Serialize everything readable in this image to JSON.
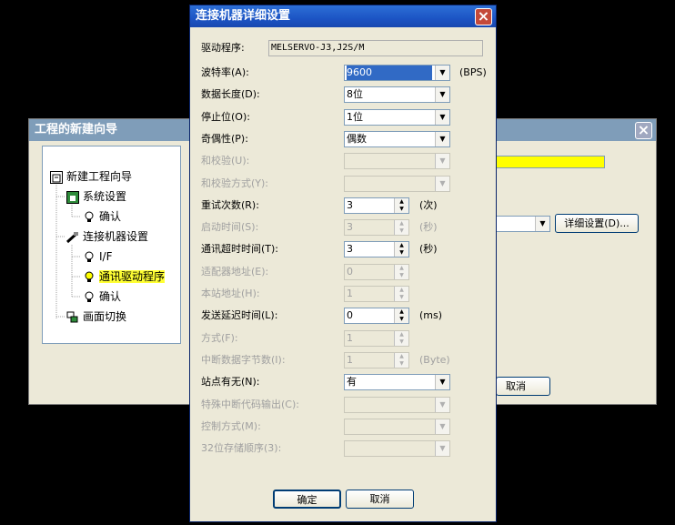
{
  "wizard": {
    "title": "工程的新建向导",
    "close": "×",
    "tree": [
      {
        "label": "新建工程向导"
      },
      {
        "label": "系统设置"
      },
      {
        "label": "确认"
      },
      {
        "label": "连接机器设置"
      },
      {
        "label": "I/F"
      },
      {
        "label": "通讯驱动程序"
      },
      {
        "label": "确认"
      },
      {
        "label": "画面切换"
      }
    ],
    "detail_button": "详细设置(D)...",
    "cancel_button": "取消",
    "highlight_color": "#ffff00"
  },
  "dialog": {
    "title": "连接机器详细设置",
    "close": "×",
    "driver_label": "驱动程序:",
    "driver_value": "MELSERVO-J3,J2S/M",
    "rows": [
      {
        "label": "波特率(A):",
        "value": "9600",
        "unit": "(BPS)",
        "type": "combo",
        "enabled": true,
        "selected": true
      },
      {
        "label": "数据长度(D):",
        "value": "8位",
        "type": "combo",
        "enabled": true
      },
      {
        "label": "停止位(O):",
        "value": "1位",
        "type": "combo",
        "enabled": true
      },
      {
        "label": "奇偶性(P):",
        "value": "偶数",
        "type": "combo",
        "enabled": true
      },
      {
        "label": "和校验(U):",
        "value": "",
        "type": "combo",
        "enabled": false
      },
      {
        "label": "和校验方式(Y):",
        "value": "",
        "type": "combo",
        "enabled": false
      },
      {
        "label": "重试次数(R):",
        "value": "3",
        "unit": "(次)",
        "type": "spin",
        "enabled": true
      },
      {
        "label": "启动时间(S):",
        "value": "3",
        "unit": "(秒)",
        "type": "spin",
        "enabled": false
      },
      {
        "label": "通讯超时时间(T):",
        "value": "3",
        "unit": "(秒)",
        "type": "spin",
        "enabled": true
      },
      {
        "label": "适配器地址(E):",
        "value": "0",
        "type": "spin",
        "enabled": false
      },
      {
        "label": "本站地址(H):",
        "value": "1",
        "type": "spin",
        "enabled": false
      },
      {
        "label": "发送延迟时间(L):",
        "value": "0",
        "unit": "(ms)",
        "type": "spin",
        "enabled": true
      },
      {
        "label": "方式(F):",
        "value": "1",
        "type": "spin",
        "enabled": false
      },
      {
        "label": "中断数据字节数(I):",
        "value": "1",
        "unit": "(Byte)",
        "type": "spin",
        "enabled": false
      },
      {
        "label": "站点有无(N):",
        "value": "有",
        "type": "combo",
        "enabled": true
      },
      {
        "label": "特殊中断代码输出(C):",
        "value": "",
        "type": "combo",
        "enabled": false
      },
      {
        "label": "控制方式(M):",
        "value": "",
        "type": "combo",
        "enabled": false
      },
      {
        "label": "32位存储顺序(3):",
        "value": "",
        "type": "combo",
        "enabled": false
      }
    ],
    "ok_button": "确定",
    "cancel_button": "取消"
  },
  "icons": {
    "combo_arrow": "▼",
    "spin_up": "▲",
    "spin_down": "▼"
  },
  "colors": {
    "titlebar_active": "#1c54c4",
    "selection": "#316ac5"
  }
}
